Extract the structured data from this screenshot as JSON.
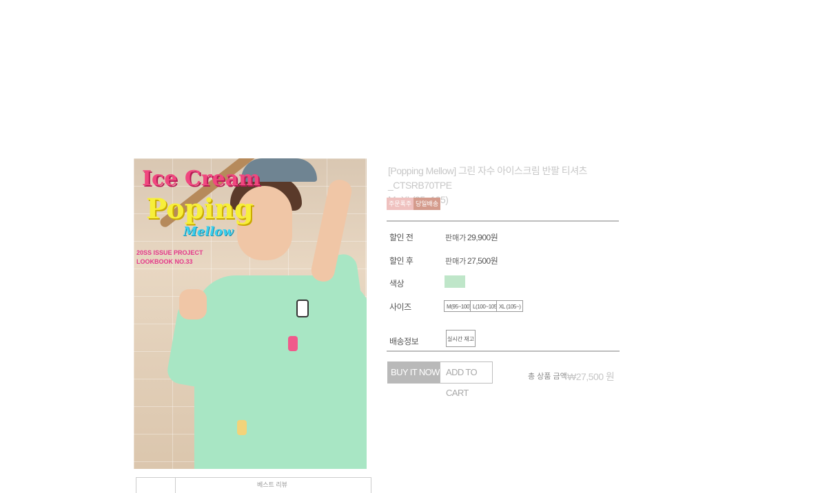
{
  "cover": {
    "title_line1": "Ice Cream",
    "title_line2": "Poping",
    "title_line3": "Mellow",
    "line1": "20SS ISSUE PROJECT",
    "line2": "LOOKBOOK NO.33"
  },
  "tabs": {
    "review_label": "베스트 리뷰"
  },
  "product": {
    "title_line1": "[Popping Mellow] 그린 자수 아이스크림 반팔 티셔츠_CTSRB70TPE",
    "title_line2": "M~XL(95~105)",
    "badges": [
      "주문폭주",
      "당일배송"
    ]
  },
  "details": {
    "before_label": "할인 전",
    "before_sub": "판매가",
    "before_price": "29,900원",
    "after_label": "할인 후",
    "after_sub": "판매가",
    "after_price": "27,500원",
    "color_label": "색상",
    "color_swatch": "#bfe6c9",
    "size_label": "사이즈",
    "sizes": [
      "M(95~100)",
      "L(100~105)",
      "XL (105~)"
    ],
    "shipping_label": "배송정보",
    "stock_button": "실시간 재고"
  },
  "actions": {
    "buy_now": "BUY IT NOW",
    "add_to_cart": "ADD TO CART"
  },
  "total": {
    "label": "총 상품 금액",
    "value": "₩27,500 원"
  }
}
